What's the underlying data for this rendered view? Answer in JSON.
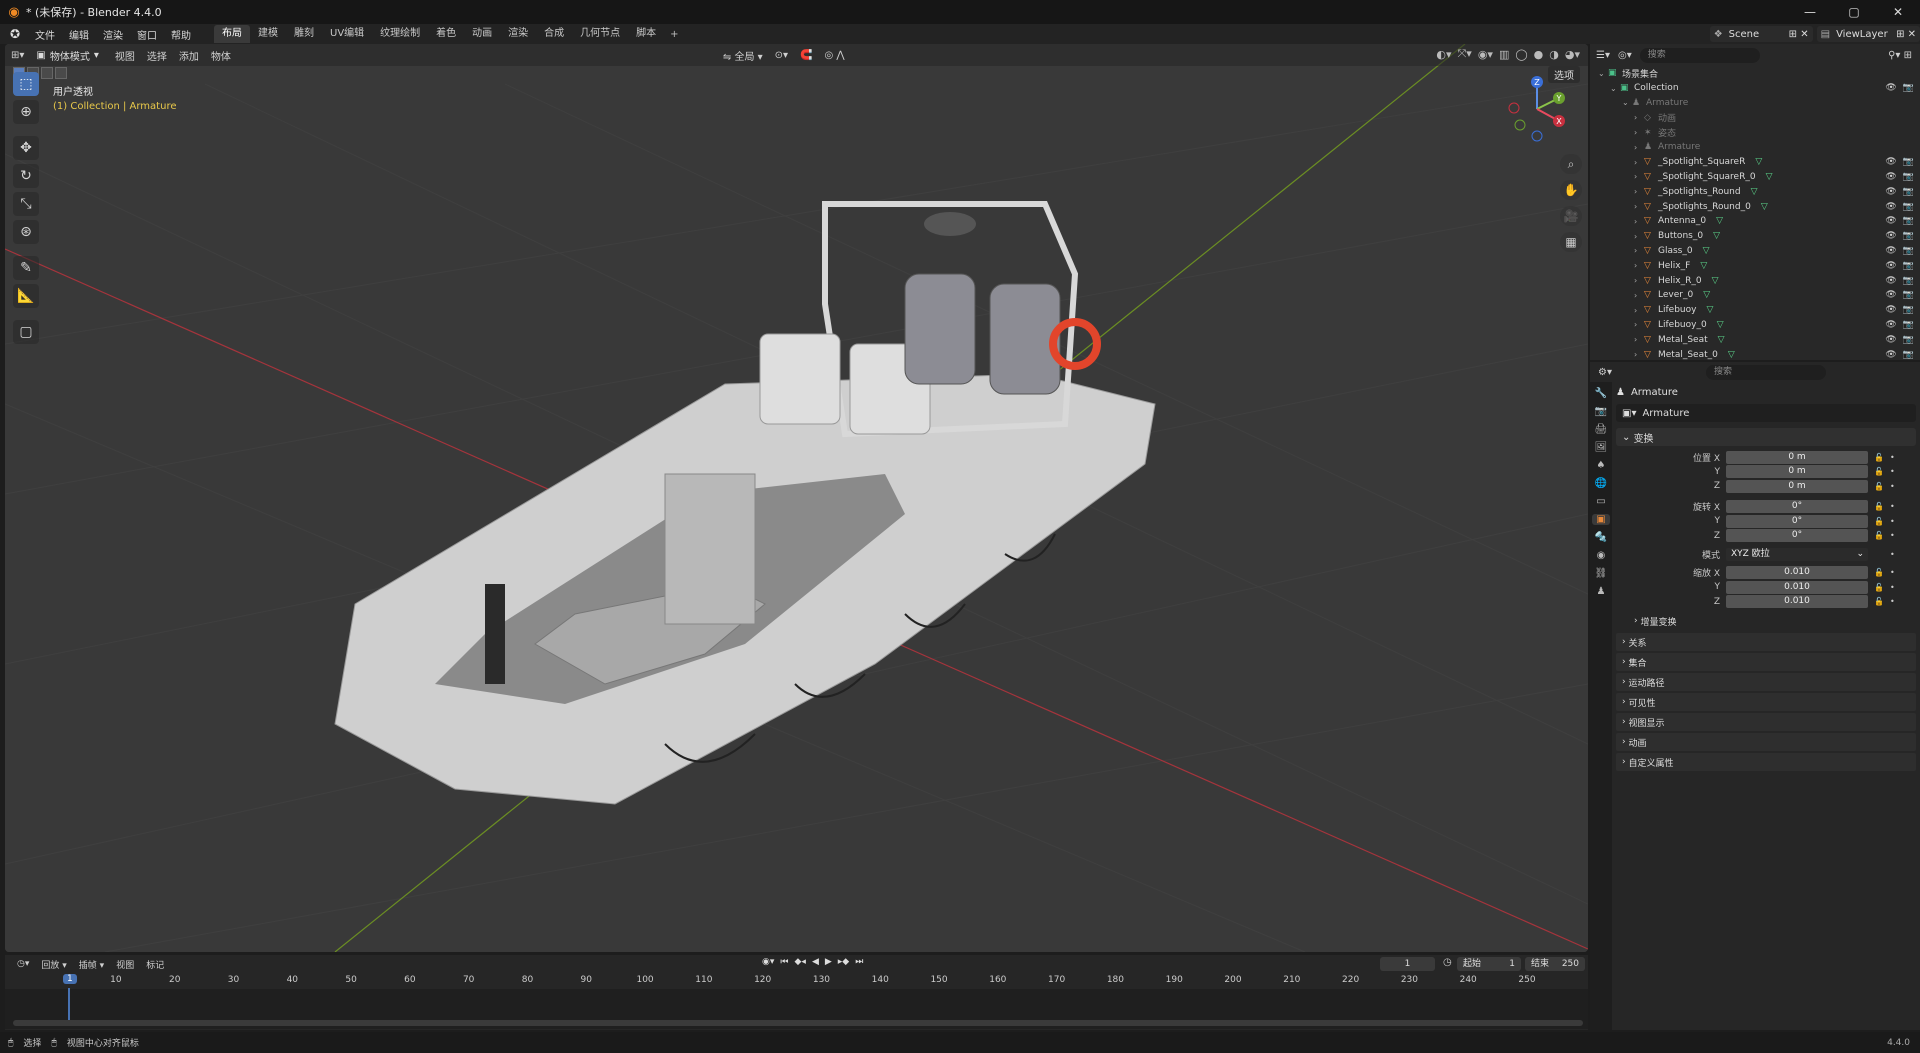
{
  "window": {
    "title": "* (未保存) - Blender 4.4.0",
    "controls": [
      "—",
      "▢",
      "✕"
    ]
  },
  "menu": {
    "items": [
      "文件",
      "编辑",
      "渲染",
      "窗口",
      "帮助"
    ]
  },
  "workspaces": {
    "tabs": [
      "布局",
      "建模",
      "雕刻",
      "UV编辑",
      "纹理绘制",
      "着色",
      "动画",
      "渲染",
      "合成",
      "几何节点",
      "脚本"
    ],
    "plus": "+",
    "active": 0
  },
  "scene": {
    "scene_name": "Scene",
    "viewlayer_name": "ViewLayer"
  },
  "viewport": {
    "mode": "物体模式",
    "menu": [
      "视图",
      "选择",
      "添加",
      "物体"
    ],
    "transform_orientation": "全局",
    "select_button": "选项",
    "info_line1": "用户透视",
    "info_line2": "(1) Collection | Armature",
    "gizmo": {
      "z": "Z",
      "y": "Y",
      "x": "X"
    }
  },
  "outliner": {
    "search_placeholder": "搜索",
    "rows": [
      {
        "label": "场景集合",
        "indent": 0,
        "icon": "▣"
      },
      {
        "label": "Collection",
        "indent": 1,
        "icon": "▣"
      },
      {
        "label": "Armature",
        "indent": 2,
        "icon": "♟",
        "dim": true
      },
      {
        "label": "动画",
        "indent": 3,
        "icon": "◇",
        "dim": true
      },
      {
        "label": "姿态",
        "indent": 3,
        "icon": "✶",
        "dim": true
      },
      {
        "label": "Armature",
        "indent": 3,
        "icon": "♟",
        "dim": true
      },
      {
        "label": "_Spotlight_SquareR",
        "indent": 3,
        "icon": "▽"
      },
      {
        "label": "_Spotlight_SquareR_0",
        "indent": 3,
        "icon": "▽"
      },
      {
        "label": "_Spotlights_Round",
        "indent": 3,
        "icon": "▽"
      },
      {
        "label": "_Spotlights_Round_0",
        "indent": 3,
        "icon": "▽"
      },
      {
        "label": "Antenna_0",
        "indent": 3,
        "icon": "▽"
      },
      {
        "label": "Buttons_0",
        "indent": 3,
        "icon": "▽"
      },
      {
        "label": "Glass_0",
        "indent": 3,
        "icon": "▽"
      },
      {
        "label": "Helix_F",
        "indent": 3,
        "icon": "▽"
      },
      {
        "label": "Helix_R_0",
        "indent": 3,
        "icon": "▽"
      },
      {
        "label": "Lever_0",
        "indent": 3,
        "icon": "▽"
      },
      {
        "label": "Lifebuoy",
        "indent": 3,
        "icon": "▽"
      },
      {
        "label": "Lifebuoy_0",
        "indent": 3,
        "icon": "▽"
      },
      {
        "label": "Metal_Seat",
        "indent": 3,
        "icon": "▽"
      },
      {
        "label": "Metal_Seat_0",
        "indent": 3,
        "icon": "▽"
      }
    ]
  },
  "properties": {
    "search_placeholder": "搜索",
    "object_title": "Armature",
    "object_name": "Armature",
    "transform_title": "变换",
    "location": {
      "label": "位置 X",
      "x": "0 m",
      "y": "0 m",
      "z": "0 m"
    },
    "rotation": {
      "label": "旋转 X",
      "x": "0°",
      "y": "0°",
      "z": "0°"
    },
    "mode": {
      "label": "模式",
      "value": "XYZ 欧拉"
    },
    "scale": {
      "label": "缩放 X",
      "x": "0.010",
      "y": "0.010",
      "z": "0.010"
    },
    "axis_y": "Y",
    "axis_z": "Z",
    "delta_transform": "增量变换",
    "collapsed_panels": [
      "关系",
      "集合",
      "运动路径",
      "可见性",
      "视图显示",
      "动画",
      "自定义属性"
    ]
  },
  "timeline": {
    "menu": [
      "回放",
      "插帧",
      "视图",
      "标记"
    ],
    "current_frame": "1",
    "start_label": "起始",
    "start": "1",
    "end_label": "结束",
    "end": "250",
    "ticks": [
      "10",
      "20",
      "30",
      "40",
      "50",
      "60",
      "70",
      "80",
      "90",
      "100",
      "110",
      "120",
      "130",
      "140",
      "150",
      "160",
      "170",
      "180",
      "190",
      "200",
      "210",
      "220",
      "230",
      "240",
      "250"
    ],
    "playhead": "1"
  },
  "status": {
    "select": "选择",
    "center": "视图中心对齐鼠标",
    "version": "4.4.0"
  }
}
